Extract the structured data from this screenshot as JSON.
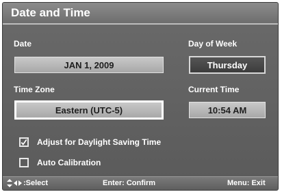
{
  "window": {
    "title": "Date and Time"
  },
  "date": {
    "label": "Date",
    "value": "JAN 1, 2009"
  },
  "day_of_week": {
    "label": "Day of Week",
    "value": "Thursday"
  },
  "time_zone": {
    "label": "Time Zone",
    "value": "Eastern (UTC-5)"
  },
  "current_time": {
    "label": "Current Time",
    "value": "10:54 AM"
  },
  "options": {
    "dst": {
      "label": "Adjust for Daylight Saving Time",
      "checked": true
    },
    "auto_calibration": {
      "label": "Auto Calibration",
      "checked": false
    }
  },
  "footer": {
    "select_label": ":Select",
    "confirm_label": "Enter: Confirm",
    "exit_label": "Menu: Exit"
  },
  "icons": {
    "nav": "up-down-left-right-arrows-icon",
    "check": "checkmark-icon"
  }
}
